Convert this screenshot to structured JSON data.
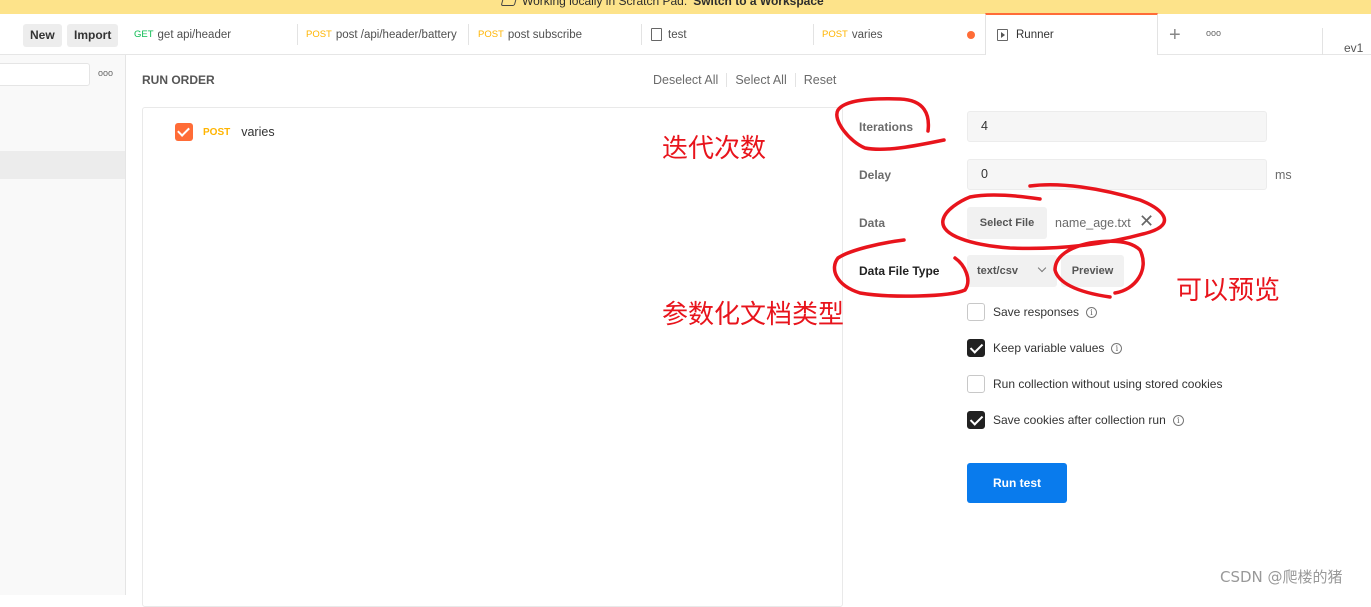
{
  "banner": {
    "text": "Working locally in Scratch Pad.",
    "link": "Switch to a Workspace"
  },
  "toolbar": {
    "new_label": "New",
    "import_label": "Import"
  },
  "tabs": [
    {
      "method": "GET",
      "label": "get api/header"
    },
    {
      "method": "POST",
      "label": "post /api/header/battery"
    },
    {
      "method": "POST",
      "label": "post subscribe"
    },
    {
      "method": "",
      "label": "test",
      "icon": "document-icon"
    },
    {
      "method": "POST",
      "label": "varies",
      "unsaved": true
    },
    {
      "method": "",
      "label": "Runner",
      "icon": "runner-icon",
      "active": true
    }
  ],
  "tab_more": "ooo",
  "environment": "ev1",
  "sidebar": {
    "more": "ooo"
  },
  "runner": {
    "run_order_title": "RUN ORDER",
    "actions": [
      "Deselect All",
      "Select All",
      "Reset"
    ],
    "requests": [
      {
        "method": "POST",
        "name": "varies",
        "checked": true
      }
    ],
    "settings": {
      "iterations_label": "Iterations",
      "iterations_value": "4",
      "delay_label": "Delay",
      "delay_value": "0",
      "delay_unit": "ms",
      "data_label": "Data",
      "select_file_label": "Select File",
      "file_name": "name_age.txt",
      "data_file_type_label": "Data File Type",
      "data_file_type_value": "text/csv",
      "preview_label": "Preview"
    },
    "options": [
      {
        "label": "Save responses",
        "checked": false,
        "info": true
      },
      {
        "label": "Keep variable values",
        "checked": true,
        "info": true
      },
      {
        "label": "Run collection without using stored cookies",
        "checked": false,
        "info": false
      },
      {
        "label": "Save cookies after collection run",
        "checked": true,
        "info": true
      }
    ],
    "run_button": "Run test"
  },
  "annotations": {
    "iterations_note": "迭代次数",
    "file_type_note": "参数化文档类型",
    "preview_note": "可以预览",
    "color": "#e8141c"
  },
  "watermark": "CSDN @爬楼的猪",
  "colors": {
    "accent": "#ff6c37",
    "primary_button": "#097bed",
    "get_method": "#0cbb52",
    "post_method": "#ffb400",
    "banner": "#fde38a"
  }
}
